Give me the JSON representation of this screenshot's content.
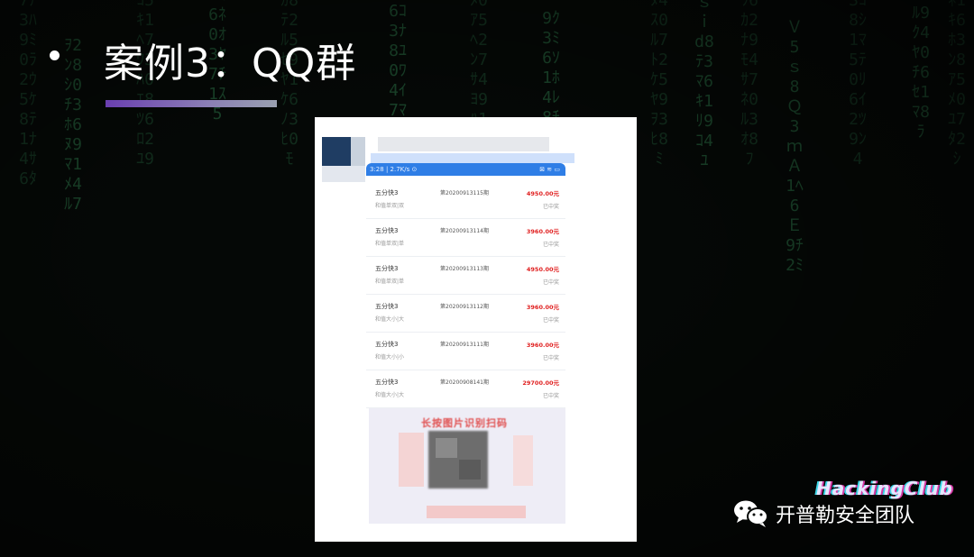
{
  "slide": {
    "title": "案例3：QQ群"
  },
  "screenshot": {
    "status_bar": {
      "time": "3:28 | 2.7K/s ⊙",
      "icons": "⊠ ≋ ▭"
    },
    "records": [
      {
        "game": "五分快3",
        "play": "和值单双|双",
        "period": "第20200913115期",
        "amount": "4950.00元",
        "status": "已中奖"
      },
      {
        "game": "五分快3",
        "play": "和值单双|单",
        "period": "第20200913114期",
        "amount": "3960.00元",
        "status": "已中奖"
      },
      {
        "game": "五分快3",
        "play": "和值单双|单",
        "period": "第20200913113期",
        "amount": "4950.00元",
        "status": "已中奖"
      },
      {
        "game": "五分快3",
        "play": "和值大小|大",
        "period": "第20200913112期",
        "amount": "3960.00元",
        "status": "已中奖"
      },
      {
        "game": "五分快3",
        "play": "和值大小|小",
        "period": "第20200913111期",
        "amount": "3960.00元",
        "status": "已中奖"
      },
      {
        "game": "五分快3",
        "play": "和值大小|大",
        "period": "第20200908141期",
        "amount": "29700.00元",
        "status": "已中奖"
      }
    ],
    "promo_text": "长按图片识别扫码"
  },
  "watermark": {
    "brand": "HackingClub",
    "team": "开普勒安全团队"
  },
  "colors": {
    "accent_red": "#e02020",
    "status_blue": "#2f7ee6",
    "underline_start": "#6a3fb0"
  }
}
